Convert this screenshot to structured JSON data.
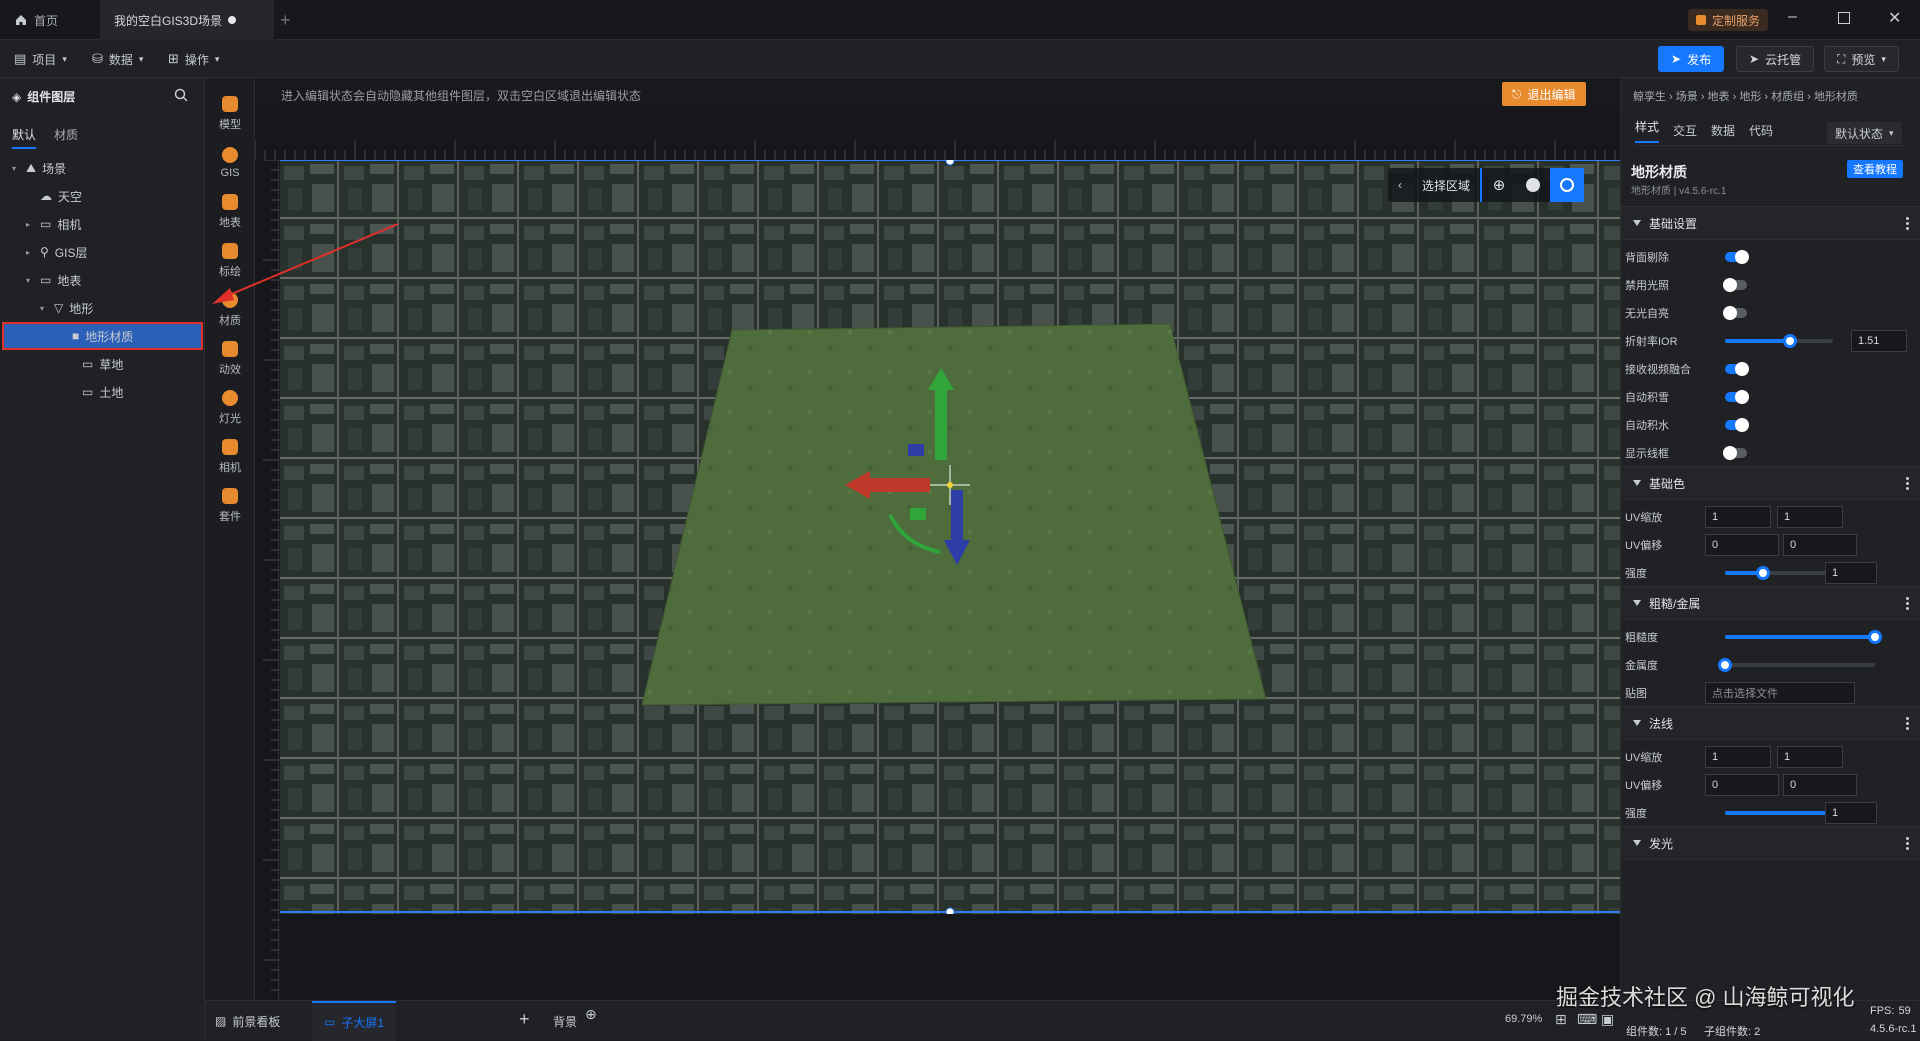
{
  "tabs": {
    "home": "首页",
    "scene": "我的空白GIS3D场景"
  },
  "titlebar": {
    "service": "定制服务"
  },
  "menubar": {
    "project": "项目",
    "data": "数据",
    "operate": "操作",
    "publish": "发布",
    "cloud": "云托管",
    "preview": "预览"
  },
  "left": {
    "title": "组件图层",
    "tabs": [
      "默认",
      "材质"
    ],
    "tree": [
      {
        "label": "场景",
        "depth": 0,
        "icon": "scene-icon",
        "expanded": true
      },
      {
        "label": "天空",
        "depth": 1,
        "icon": "sky-icon"
      },
      {
        "label": "相机",
        "depth": 1,
        "icon": "folder-icon",
        "collapsed": true
      },
      {
        "label": "GIS层",
        "depth": 1,
        "icon": "gis-icon",
        "collapsed": true
      },
      {
        "label": "地表",
        "depth": 1,
        "icon": "folder-icon",
        "expanded": true
      },
      {
        "label": "地形",
        "depth": 2,
        "icon": "terrain-icon",
        "expanded": true
      },
      {
        "label": "地形材质",
        "depth": 3,
        "icon": "material-icon",
        "selected": true
      },
      {
        "label": "草地",
        "depth": 4,
        "icon": "folder-icon"
      },
      {
        "label": "土地",
        "depth": 4,
        "icon": "folder-icon"
      }
    ]
  },
  "tools": [
    {
      "label": "模型",
      "icon": "model-icon"
    },
    {
      "label": "GIS",
      "icon": "gis-icon"
    },
    {
      "label": "地表",
      "icon": "surface-icon"
    },
    {
      "label": "标绘",
      "icon": "pin-icon"
    },
    {
      "label": "材质",
      "icon": "material-icon"
    },
    {
      "label": "动效",
      "icon": "effect-icon"
    },
    {
      "label": "灯光",
      "icon": "light-icon"
    },
    {
      "label": "相机",
      "icon": "camera-icon"
    },
    {
      "label": "套件",
      "icon": "kit-icon"
    }
  ],
  "viewport": {
    "hint": "进入编辑状态会自动隐藏其他组件图层，双击空白区域退出编辑状态",
    "exit_edit": "退出编辑",
    "select_area": "选择区域"
  },
  "right": {
    "breadcrumb": "鲸孪生 › 场景 › 地表 › 地形 › 材质组 › 地形材质",
    "tabs": [
      "样式",
      "交互",
      "数据",
      "代码"
    ],
    "state": "默认状态",
    "title": "地形材质",
    "version": "地形材质 | v4.5.6-rc.1",
    "tutorial": "查看教程",
    "sections": {
      "basic": {
        "title": "基础设置",
        "rows": [
          {
            "label": "背面剔除",
            "on": true
          },
          {
            "label": "禁用光照",
            "on": false
          },
          {
            "label": "无光自亮",
            "on": false
          },
          {
            "label": "折射率IOR",
            "slider": 0.6,
            "value": "1.51"
          },
          {
            "label": "接收视频融合",
            "on": true
          },
          {
            "label": "自动积雪",
            "on": true
          },
          {
            "label": "自动积水",
            "on": true
          },
          {
            "label": "显示线框",
            "on": false
          }
        ]
      },
      "basecolor": {
        "title": "基础色",
        "uvscale": [
          "1",
          "1"
        ],
        "uvoffset": [
          "0",
          "0"
        ],
        "intensity": "1",
        "intensity_slider": 0.35,
        "labels": {
          "uvscale": "UV缩放",
          "uvoffset": "UV偏移",
          "intensity": "强度"
        }
      },
      "rough": {
        "title": "粗糙/金属",
        "rough_label": "粗糙度",
        "rough": 1.0,
        "metal_label": "金属度",
        "metal": 0.0,
        "map_label": "贴图",
        "map_placeholder": "点击选择文件"
      },
      "normal": {
        "title": "法线",
        "uvscale": [
          "1",
          "1"
        ],
        "uvoffset": [
          "0",
          "0"
        ],
        "intensity": "1",
        "intensity_slider": 1.0,
        "labels": {
          "uvscale": "UV缩放",
          "uvoffset": "UV偏移",
          "intensity": "强度"
        }
      },
      "emission": {
        "title": "发光"
      }
    }
  },
  "bottom": {
    "storyboard": "前景看板",
    "screen": "子大屏1",
    "background": "背景",
    "zoom": "69.79%"
  },
  "status": {
    "components": "组件数: 1 / 5",
    "subcomponents": "子组件数: 2",
    "version": "4.5.6-rc.1",
    "fps": "59",
    "stats_prefix": "FPS:"
  },
  "watermark": "掘金技术社区 @ 山海鲸可视化",
  "colors": {
    "accent": "#1677ff",
    "selection": "#e0302a",
    "warning": "#e88a2e"
  }
}
